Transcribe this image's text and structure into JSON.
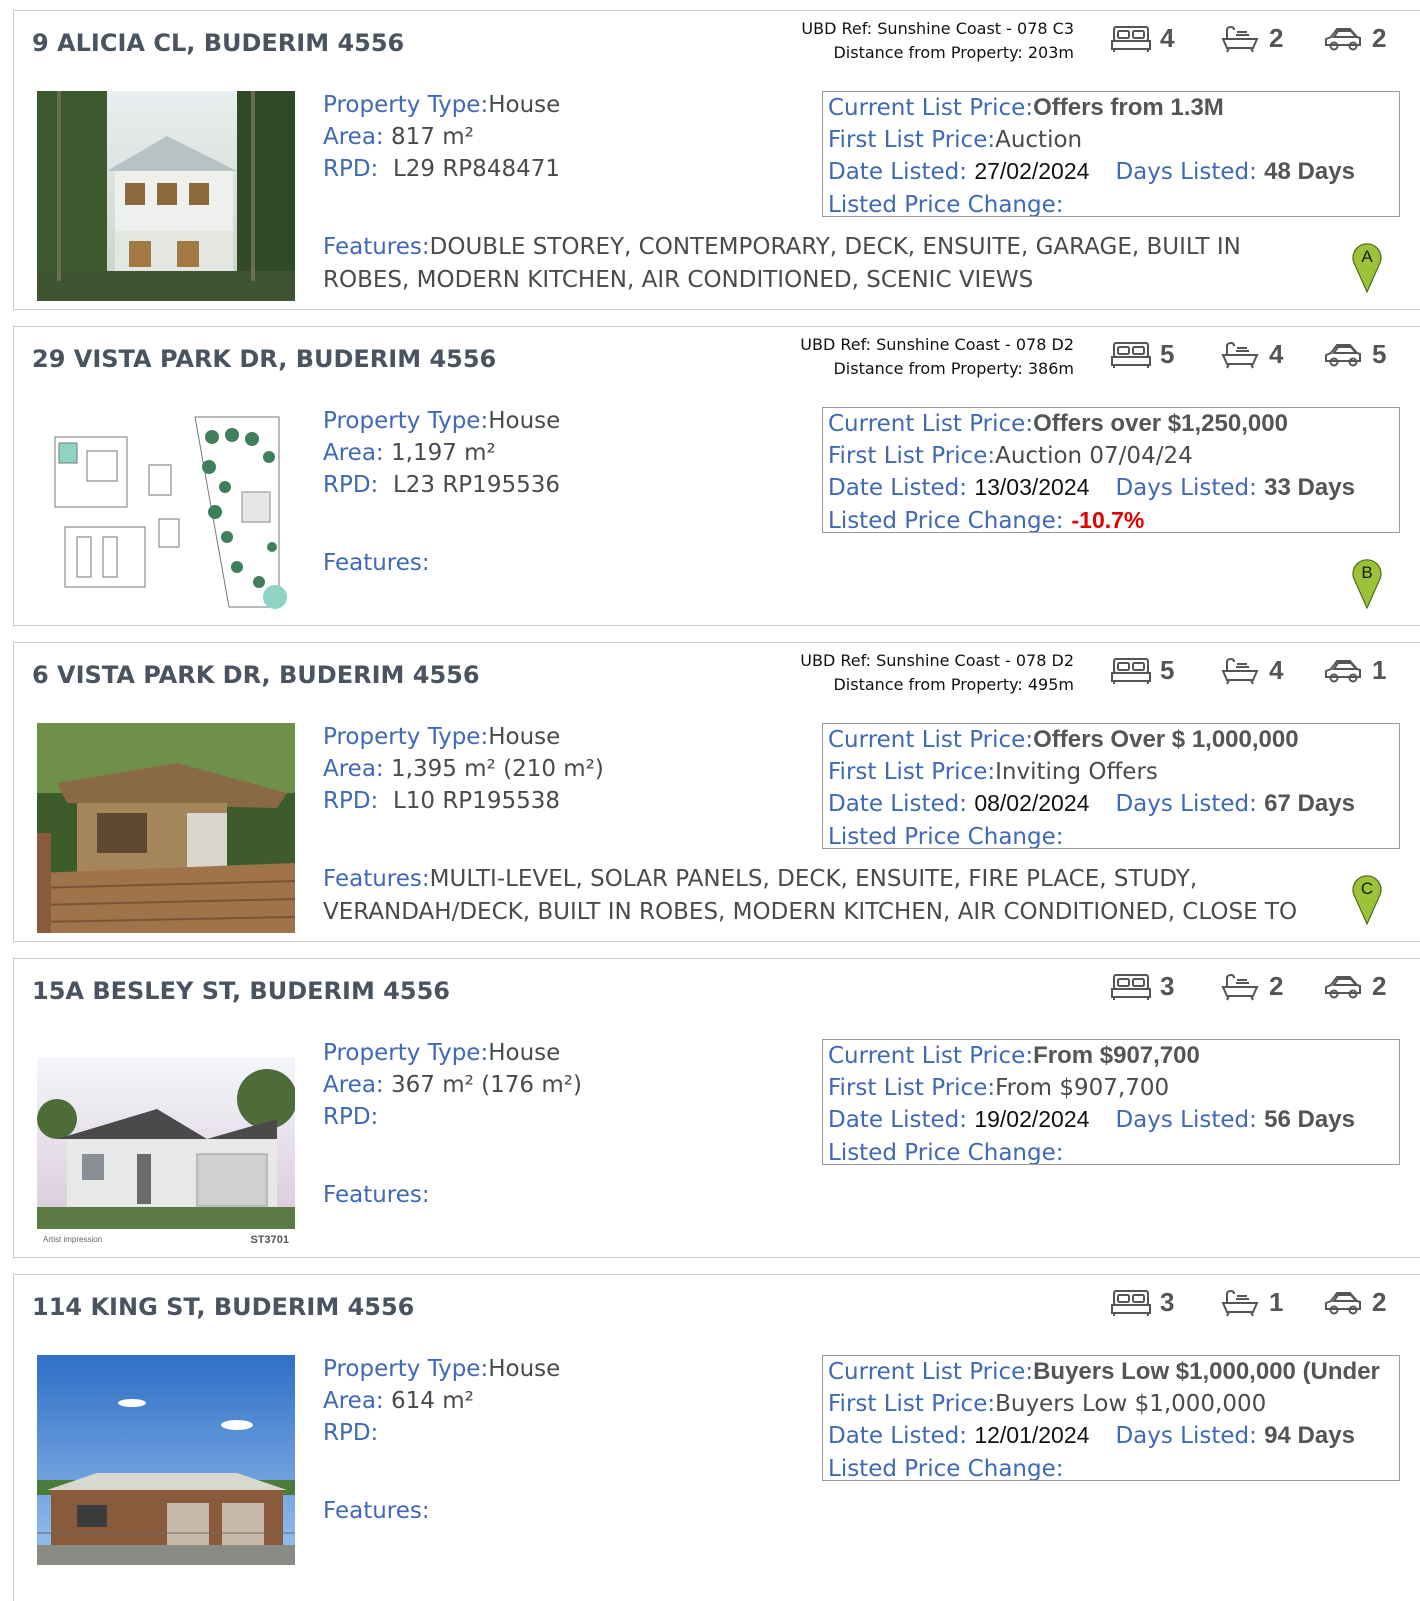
{
  "labels": {
    "property_type": "Property Type:",
    "area": "Area:",
    "rpd": "RPD:",
    "features": "Features:",
    "current_price": "Current List Price:",
    "first_price": "First List Price:",
    "date_listed": "Date Listed:",
    "days_listed": "Days Listed:",
    "price_change": "Listed Price Change:"
  },
  "icons": {
    "bed": "bed-icon",
    "bath": "bath-icon",
    "car": "car-icon",
    "pin": "map-pin-icon"
  },
  "colors": {
    "label_blue": "#3f68b5",
    "pin_green": "#9cc23a",
    "negative_red": "#e00000"
  },
  "listings": [
    {
      "address": "9 ALICIA CL, BUDERIM 4556",
      "ubd_ref": "UBD Ref: Sunshine Coast  - 078  C3",
      "distance": "Distance from Property: 203m",
      "beds": "4",
      "baths": "2",
      "cars": "2",
      "property_type": "House",
      "area": "817 m²",
      "rpd": "L29 RP848471",
      "current_price": "Offers from 1.3M",
      "first_price": "Auction",
      "date_listed": "27/02/2024",
      "days_listed": "48 Days",
      "price_change": "",
      "features": "DOUBLE STOREY, CONTEMPORARY, DECK, ENSUITE, GARAGE, BUILT IN ROBES, MODERN KITCHEN, AIR CONDITIONED, SCENIC VIEWS",
      "marker": "A",
      "photo": "two-storey-white-house-photo"
    },
    {
      "address": "29 VISTA PARK DR, BUDERIM 4556",
      "ubd_ref": "UBD Ref: Sunshine Coast  - 078  D2",
      "distance": "Distance from Property: 386m",
      "beds": "5",
      "baths": "4",
      "cars": "5",
      "property_type": "House",
      "area": "1,197 m²",
      "rpd": "L23 RP195536",
      "current_price": "Offers over $1,250,000",
      "first_price": "Auction 07/04/24",
      "date_listed": "13/03/2024",
      "days_listed": "33 Days",
      "price_change": "-10.7%",
      "features": "",
      "marker": "B",
      "photo": "floor-plan-image"
    },
    {
      "address": "6 VISTA PARK DR, BUDERIM 4556",
      "ubd_ref": "UBD Ref: Sunshine Coast  - 078  D2",
      "distance": "Distance from Property: 495m",
      "beds": "5",
      "baths": "4",
      "cars": "1",
      "property_type": "House",
      "area": "1,395 m² (210 m²)",
      "rpd": "L10 RP195538",
      "current_price": "Offers Over $ 1,000,000",
      "first_price": "Inviting Offers",
      "date_listed": "08/02/2024",
      "days_listed": "67 Days",
      "price_change": "",
      "features": "MULTI-LEVEL, SOLAR PANELS, DECK, ENSUITE, FIRE PLACE, STUDY, VERANDAH/DECK, BUILT IN ROBES, MODERN KITCHEN, AIR CONDITIONED, CLOSE TO",
      "marker": "C",
      "photo": "timber-deck-house-photo"
    },
    {
      "address": "15A BESLEY ST, BUDERIM 4556",
      "ubd_ref": "",
      "distance": "",
      "beds": "3",
      "baths": "2",
      "cars": "2",
      "property_type": "House",
      "area": "367 m² (176 m²)",
      "rpd": "",
      "current_price": "From $907,700",
      "first_price": "From $907,700",
      "date_listed": "19/02/2024",
      "days_listed": "56 Days",
      "price_change": "",
      "features": "",
      "marker": "",
      "photo": "house-render-image",
      "photo_caption_left": "Artist impression",
      "photo_caption_right": "ST3701"
    },
    {
      "address": "114 KING ST, BUDERIM 4556",
      "ubd_ref": "",
      "distance": "",
      "beds": "3",
      "baths": "1",
      "cars": "2",
      "property_type": "House",
      "area": "614 m²",
      "rpd": "",
      "current_price": "Buyers Low $1,000,000 (Under",
      "first_price": "Buyers Low $1,000,000",
      "date_listed": "12/01/2024",
      "days_listed": "94 Days",
      "price_change": "",
      "features": "",
      "marker": "",
      "photo": "brick-house-photo"
    }
  ]
}
